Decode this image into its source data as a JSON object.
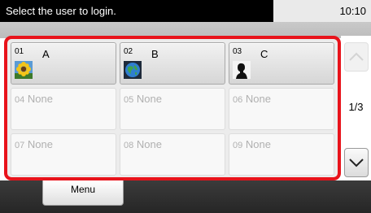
{
  "status_bar": {
    "message": "Select the user to login.",
    "time": "10:10"
  },
  "users": [
    {
      "number": "01",
      "name": "A",
      "icon": "sunflower-icon"
    },
    {
      "number": "02",
      "name": "B",
      "icon": "globe-icon"
    },
    {
      "number": "03",
      "name": "C",
      "icon": "silhouette-icon"
    },
    {
      "number": "04",
      "name": "None"
    },
    {
      "number": "05",
      "name": "None"
    },
    {
      "number": "06",
      "name": "None"
    },
    {
      "number": "07",
      "name": "None"
    },
    {
      "number": "08",
      "name": "None"
    },
    {
      "number": "09",
      "name": "None"
    }
  ],
  "pagination": {
    "indicator": "1/3",
    "up_icon": "chevron-up-icon",
    "down_icon": "chevron-down-icon"
  },
  "footer": {
    "menu_label": "Menu"
  },
  "colors": {
    "highlight_border": "#e8131b"
  }
}
